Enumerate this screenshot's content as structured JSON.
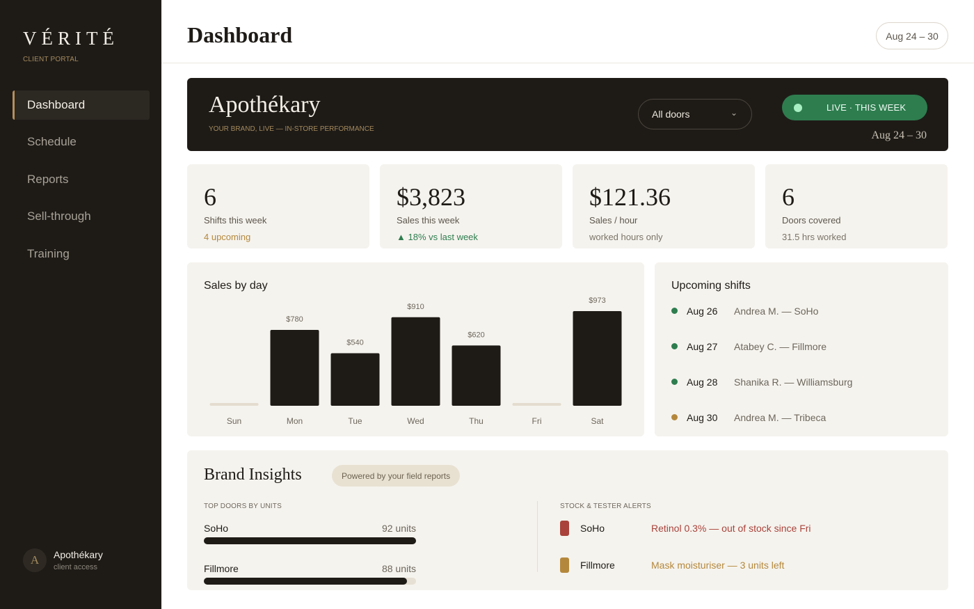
{
  "sidebar": {
    "brand": "VÉRITÉ",
    "subtitle": "CLIENT PORTAL",
    "items": [
      {
        "label": "Dashboard",
        "active": true
      },
      {
        "label": "Schedule",
        "active": false
      },
      {
        "label": "Reports",
        "active": false
      },
      {
        "label": "Sell-through",
        "active": false
      },
      {
        "label": "Training",
        "active": false
      }
    ],
    "user": {
      "initial": "A",
      "name": "Apothékary",
      "role": "client access"
    }
  },
  "header": {
    "title": "Dashboard",
    "date_range": "Aug 24 – 30"
  },
  "hero": {
    "title": "Apothékary",
    "subtitle": "YOUR BRAND, LIVE — IN-STORE PERFORMANCE",
    "doors_select": "All doors",
    "live_label": "LIVE · THIS WEEK",
    "date": "Aug 24 – 30"
  },
  "stats": [
    {
      "value": "6",
      "label": "Shifts this week",
      "note": "4 upcoming"
    },
    {
      "value": "$3,823",
      "label": "Sales this week",
      "note": "▲ 18% vs last week"
    },
    {
      "value": "$121.36",
      "label": "Sales / hour",
      "note": "worked hours only"
    },
    {
      "value": "6",
      "label": "Doors covered",
      "note": "31.5 hrs worked"
    }
  ],
  "sales_chart": {
    "title": "Sales by day"
  },
  "chart_data": {
    "type": "bar",
    "title": "Sales by day",
    "categories": [
      "Sun",
      "Mon",
      "Tue",
      "Wed",
      "Thu",
      "Fri",
      "Sat"
    ],
    "values": [
      0,
      780,
      540,
      910,
      620,
      0,
      973
    ],
    "data_labels": [
      "",
      "$780",
      "$540",
      "$910",
      "$620",
      "",
      "$973"
    ],
    "ylim": [
      0,
      973
    ],
    "grid": false,
    "colors": {
      "bar": "#1e1b17",
      "empty": "#e3dccf"
    }
  },
  "upcoming": {
    "title": "Upcoming shifts",
    "shifts": [
      {
        "date": "Aug 26",
        "who": "Andrea M. — SoHo",
        "color": "#2e7d4f"
      },
      {
        "date": "Aug 27",
        "who": "Atabey C. — Fillmore",
        "color": "#2e7d4f"
      },
      {
        "date": "Aug 28",
        "who": "Shanika R. — Williamsburg",
        "color": "#2e7d4f"
      },
      {
        "date": "Aug 30",
        "who": "Andrea M. — Tribeca",
        "color": "#b4883c"
      }
    ]
  },
  "insights": {
    "title": "Brand Insights",
    "powered": "Powered by your field reports",
    "top_doors_label": "TOP DOORS BY UNITS",
    "top_doors": [
      {
        "name": "SoHo",
        "units": "92 units",
        "fraction": 1.0
      },
      {
        "name": "Fillmore",
        "units": "88 units",
        "fraction": 0.957
      }
    ],
    "alerts_label": "STOCK & TESTER ALERTS",
    "alerts": [
      {
        "door": "SoHo",
        "message": "Retinol 0.3% — out of stock since Fri",
        "color": "#a8423a"
      },
      {
        "door": "Fillmore",
        "message": "Mask moisturiser — 3 units left",
        "color": "#b4883c"
      }
    ]
  }
}
